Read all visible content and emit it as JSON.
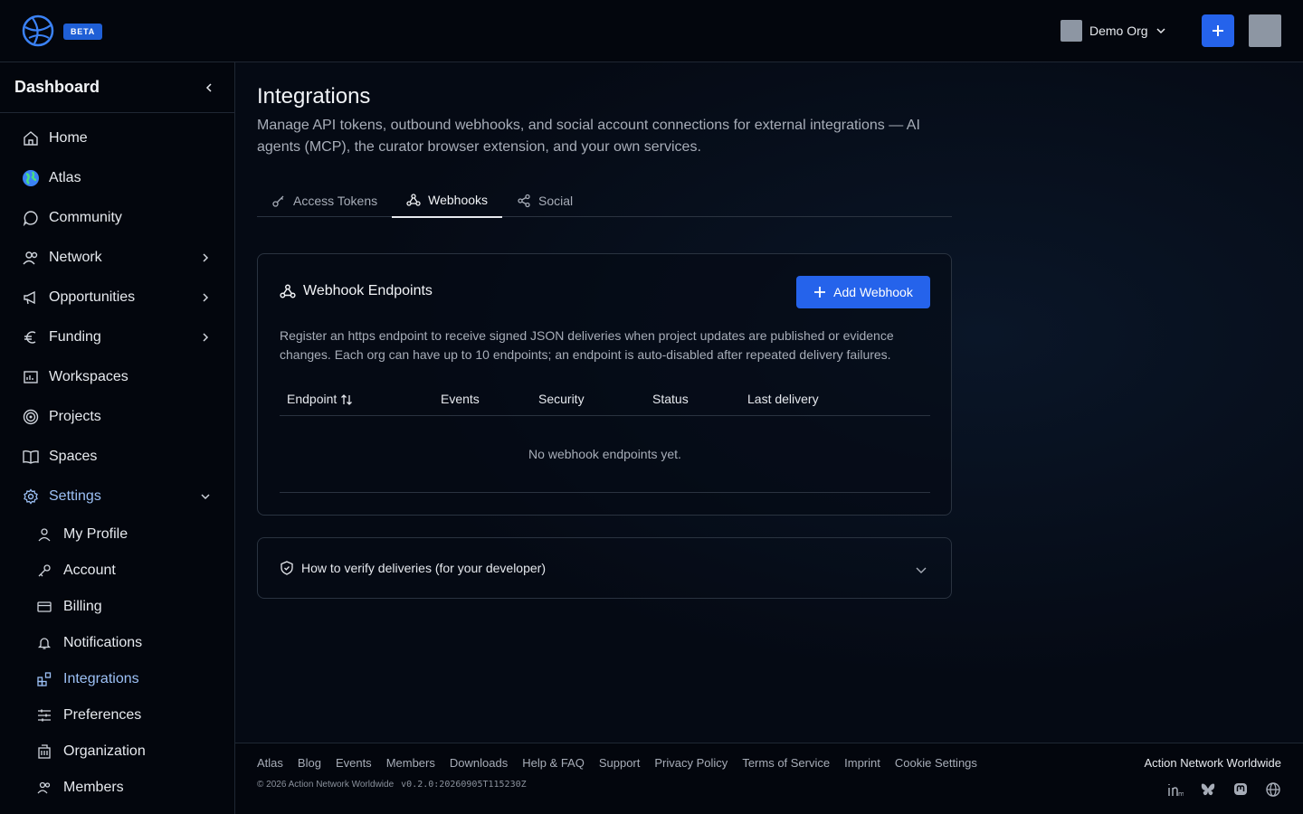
{
  "topbar": {
    "beta_label": "BETA",
    "org_name": "Demo Org"
  },
  "sidebar": {
    "title": "Dashboard",
    "items": [
      {
        "label": "Home"
      },
      {
        "label": "Atlas"
      },
      {
        "label": "Community"
      },
      {
        "label": "Network"
      },
      {
        "label": "Opportunities"
      },
      {
        "label": "Funding"
      },
      {
        "label": "Workspaces"
      },
      {
        "label": "Projects"
      },
      {
        "label": "Spaces"
      },
      {
        "label": "Settings"
      }
    ],
    "sub_items": [
      {
        "label": "My Profile"
      },
      {
        "label": "Account"
      },
      {
        "label": "Billing"
      },
      {
        "label": "Notifications"
      },
      {
        "label": "Integrations"
      },
      {
        "label": "Preferences"
      },
      {
        "label": "Organization"
      },
      {
        "label": "Members"
      }
    ]
  },
  "main": {
    "title": "Integrations",
    "description": "Manage API tokens, outbound webhooks, and social account connections for external integrations — AI agents (MCP), the curator browser extension, and your own services.",
    "tabs": [
      {
        "label": "Access Tokens"
      },
      {
        "label": "Webhooks"
      },
      {
        "label": "Social"
      }
    ],
    "card": {
      "title": "Webhook Endpoints",
      "add_button": "Add Webhook",
      "description": "Register an https endpoint to receive signed JSON deliveries when project updates are published or evidence changes. Each org can have up to 10 endpoints; an endpoint is auto-disabled after repeated delivery failures.",
      "columns": [
        "Endpoint",
        "Events",
        "Security",
        "Status",
        "Last delivery"
      ],
      "empty_text": "No webhook endpoints yet."
    },
    "accordion_label": "How to verify deliveries (for your developer)"
  },
  "footer": {
    "links": [
      "Atlas",
      "Blog",
      "Events",
      "Members",
      "Downloads",
      "Help & FAQ",
      "Support",
      "Privacy Policy",
      "Terms of Service",
      "Imprint",
      "Cookie Settings"
    ],
    "copyright": "© 2026 Action Network Worldwide",
    "version": "v0.2.0:20260905T115230Z",
    "brand": "Action Network Worldwide"
  },
  "colors": {
    "accent": "#2563eb",
    "active_nav": "#9cc0f5",
    "background": "#050a14"
  }
}
